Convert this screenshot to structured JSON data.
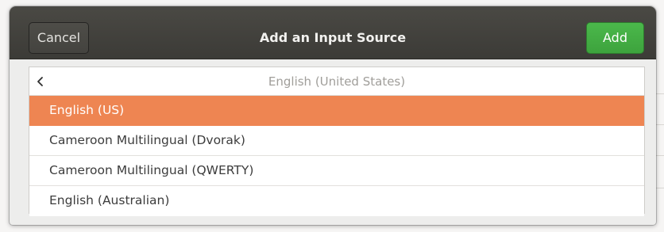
{
  "dialog": {
    "title": "Add an Input Source",
    "cancel_label": "Cancel",
    "add_label": "Add"
  },
  "list": {
    "header_title": "English (United States)",
    "back_icon": "chevron-left-icon",
    "items": [
      {
        "label": "English (US)",
        "selected": true
      },
      {
        "label": "Cameroon Multilingual (Dvorak)",
        "selected": false
      },
      {
        "label": "Cameroon Multilingual (QWERTY)",
        "selected": false
      },
      {
        "label": "English (Australian)",
        "selected": false
      }
    ]
  },
  "colors": {
    "headerbar": "#3c3b37",
    "add_button": "#3da33d",
    "selection": "#ee8552"
  }
}
